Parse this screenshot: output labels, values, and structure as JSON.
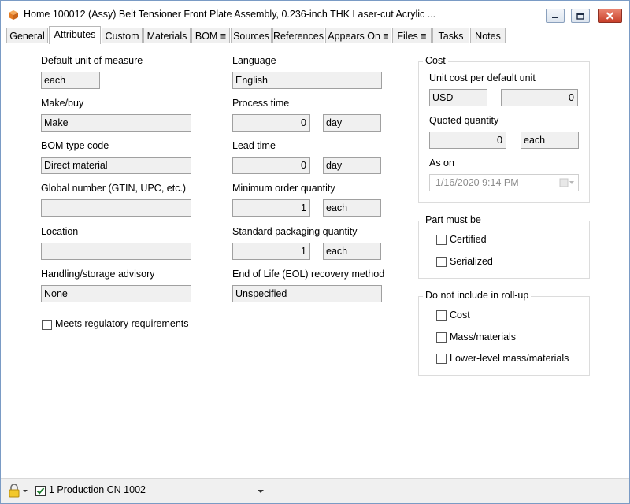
{
  "window": {
    "title": "Home 100012 (Assy) Belt Tensioner Front Plate Assembly, 0.236-inch THK Laser-cut Acrylic ...",
    "minimize_icon": "minimize-icon",
    "maximize_icon": "maximize-icon",
    "close_icon": "close-icon"
  },
  "tabs": [
    {
      "label": "General",
      "active": false
    },
    {
      "label": "Attributes",
      "active": true
    },
    {
      "label": "Custom",
      "active": false
    },
    {
      "label": "Materials",
      "active": false
    },
    {
      "label": "BOM ≡",
      "active": false
    },
    {
      "label": "Sources",
      "active": false
    },
    {
      "label": "References",
      "active": false
    },
    {
      "label": "Appears On ≡",
      "active": false
    },
    {
      "label": "Files ≡",
      "active": false
    },
    {
      "label": "Tasks",
      "active": false
    },
    {
      "label": "Notes",
      "active": false
    }
  ],
  "left": {
    "default_uom_label": "Default unit of measure",
    "default_uom_value": "each",
    "make_buy_label": "Make/buy",
    "make_buy_value": "Make",
    "bom_type_label": "BOM type code",
    "bom_type_value": "Direct material",
    "global_number_label": "Global number (GTIN, UPC, etc.)",
    "global_number_value": "",
    "location_label": "Location",
    "location_value": "",
    "handling_label": "Handling/storage advisory",
    "handling_value": "None",
    "regulatory_label": "Meets regulatory requirements",
    "regulatory_checked": false
  },
  "middle": {
    "language_label": "Language",
    "language_value": "English",
    "process_time_label": "Process time",
    "process_time_value": "0",
    "process_time_unit": "day",
    "lead_time_label": "Lead time",
    "lead_time_value": "0",
    "lead_time_unit": "day",
    "min_order_label": "Minimum order quantity",
    "min_order_value": "1",
    "min_order_unit": "each",
    "std_pack_label": "Standard packaging quantity",
    "std_pack_value": "1",
    "std_pack_unit": "each",
    "eol_label": "End of Life (EOL) recovery method",
    "eol_value": "Unspecified"
  },
  "cost": {
    "group_title": "Cost",
    "unit_cost_label": "Unit cost per default unit",
    "currency": "USD",
    "unit_cost_value": "0",
    "quoted_qty_label": "Quoted quantity",
    "quoted_qty_value": "0",
    "quoted_qty_unit": "each",
    "as_on_label": "As on",
    "as_on_value": "1/16/2020   9:14 PM"
  },
  "part_must_be": {
    "group_title": "Part must be",
    "certified_label": "Certified",
    "certified_checked": false,
    "serialized_label": "Serialized",
    "serialized_checked": false
  },
  "rollup": {
    "group_title": "Do not include in roll-up",
    "cost_label": "Cost",
    "mass_label": "Mass/materials",
    "lower_mass_label": "Lower-level mass/materials"
  },
  "status": {
    "lock_icon": "lock-icon",
    "change_notice": "1 Production CN 1002",
    "change_notice_checked": true
  }
}
